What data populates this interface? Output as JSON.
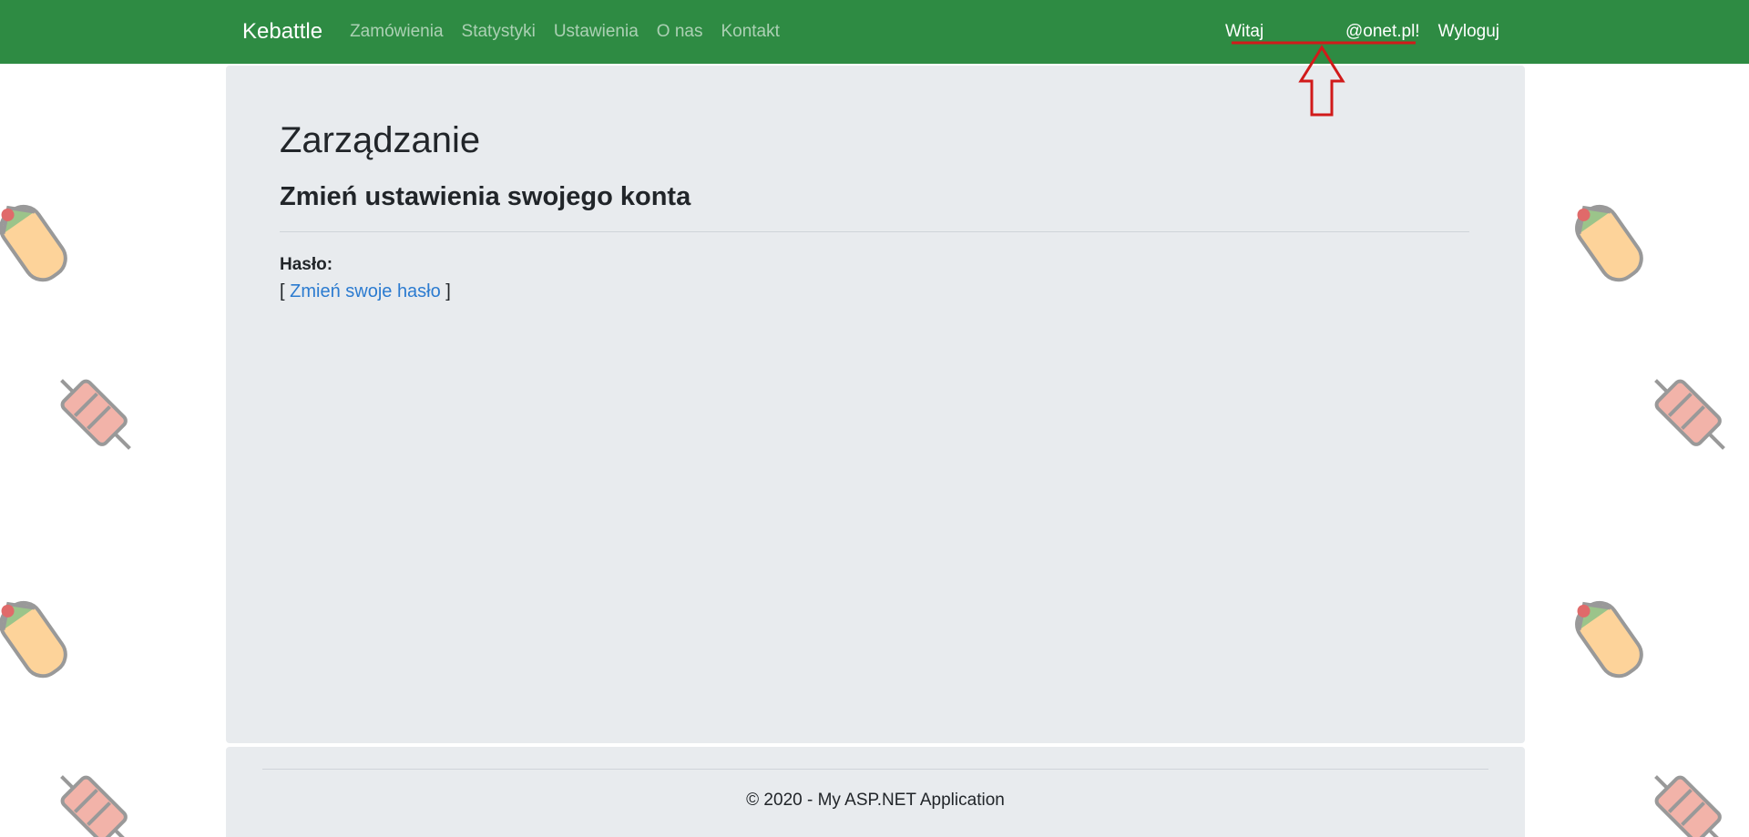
{
  "navbar": {
    "brand": "Kebattle",
    "links": [
      "Zamówienia",
      "Statystyki",
      "Ustawienia",
      "O nas",
      "Kontakt"
    ],
    "greeting": "Witaj                 @onet.pl!",
    "logout": "Wyloguj",
    "color": "#2e8b43"
  },
  "main": {
    "title": "Zarządzanie",
    "subtitle": "Zmień ustawienia swojego konta",
    "password_label": "Hasło:",
    "bracket_open": "[ ",
    "change_password_link": "Zmień swoje hasło",
    "bracket_close": " ]"
  },
  "footer": {
    "copyright": "© 2020 - My ASP.NET Application"
  },
  "decorations": {
    "background_icons": [
      "burrito-icon",
      "kebab-skewer-icon"
    ],
    "annotation": "red-arrow-icon"
  }
}
